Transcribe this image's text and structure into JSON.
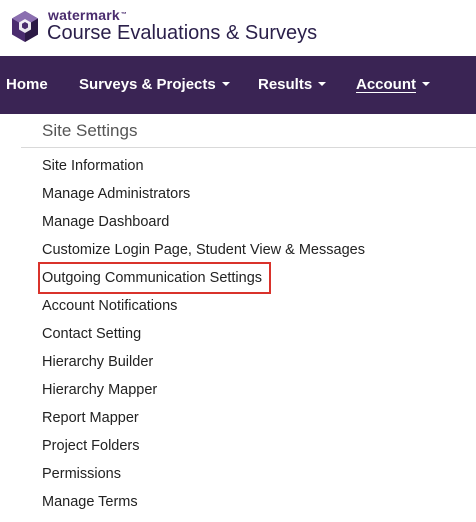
{
  "brand": {
    "company": "watermark",
    "trademark": "™",
    "product": "Course Evaluations & Surveys",
    "logo_icon": "watermark-hexagon-logo"
  },
  "navbar": {
    "items": [
      {
        "label": "Home",
        "has_dropdown": false,
        "active": false
      },
      {
        "label": "Surveys & Projects",
        "has_dropdown": true,
        "active": false
      },
      {
        "label": "Results",
        "has_dropdown": true,
        "active": false
      },
      {
        "label": "Account",
        "has_dropdown": true,
        "active": true
      }
    ]
  },
  "site_settings": {
    "title": "Site Settings",
    "items": [
      {
        "label": "Site Information"
      },
      {
        "label": "Manage Administrators"
      },
      {
        "label": "Manage Dashboard"
      },
      {
        "label": "Customize Login Page, Student View & Messages"
      },
      {
        "label": "Outgoing Communication Settings",
        "highlighted": true
      },
      {
        "label": "Account Notifications"
      },
      {
        "label": "Contact Setting"
      },
      {
        "label": "Hierarchy Builder"
      },
      {
        "label": "Hierarchy Mapper"
      },
      {
        "label": "Report Mapper"
      },
      {
        "label": "Project Folders"
      },
      {
        "label": "Permissions"
      },
      {
        "label": "Manage Terms"
      }
    ]
  },
  "colors": {
    "navbar_bg": "#3a2454",
    "brand_purple": "#4a2c6e",
    "highlight_red": "#d9322b"
  }
}
